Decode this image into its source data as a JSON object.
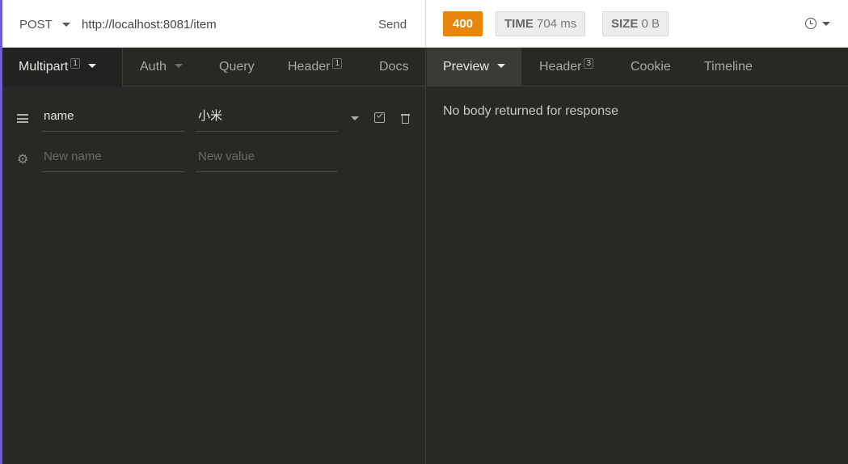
{
  "request": {
    "method": "POST",
    "url": "http://localhost:8081/item",
    "send_label": "Send"
  },
  "response": {
    "status_code": "400",
    "time_label": "TIME",
    "time_value": "704 ms",
    "size_label": "SIZE",
    "size_value": "0 B",
    "status_color": "#e8860c"
  },
  "request_tabs": {
    "multipart": {
      "label": "Multipart",
      "count": "1"
    },
    "auth": {
      "label": "Auth"
    },
    "query": {
      "label": "Query"
    },
    "header": {
      "label": "Header",
      "count": "1"
    },
    "docs": {
      "label": "Docs"
    }
  },
  "response_tabs": {
    "preview": {
      "label": "Preview"
    },
    "header": {
      "label": "Header",
      "count": "3"
    },
    "cookie": {
      "label": "Cookie"
    },
    "timeline": {
      "label": "Timeline"
    }
  },
  "params": [
    {
      "name": "name",
      "value": "小米"
    }
  ],
  "new_param": {
    "name_placeholder": "New name",
    "value_placeholder": "New value"
  },
  "response_body": {
    "message": "No body returned for response"
  },
  "icons": {
    "method_dropdown": "chevron-down-icon",
    "history": "clock-icon",
    "row_handle": "drag-handle-icon",
    "settings": "gear-icon",
    "enable": "checkbox-checked-icon",
    "delete": "trash-icon"
  }
}
